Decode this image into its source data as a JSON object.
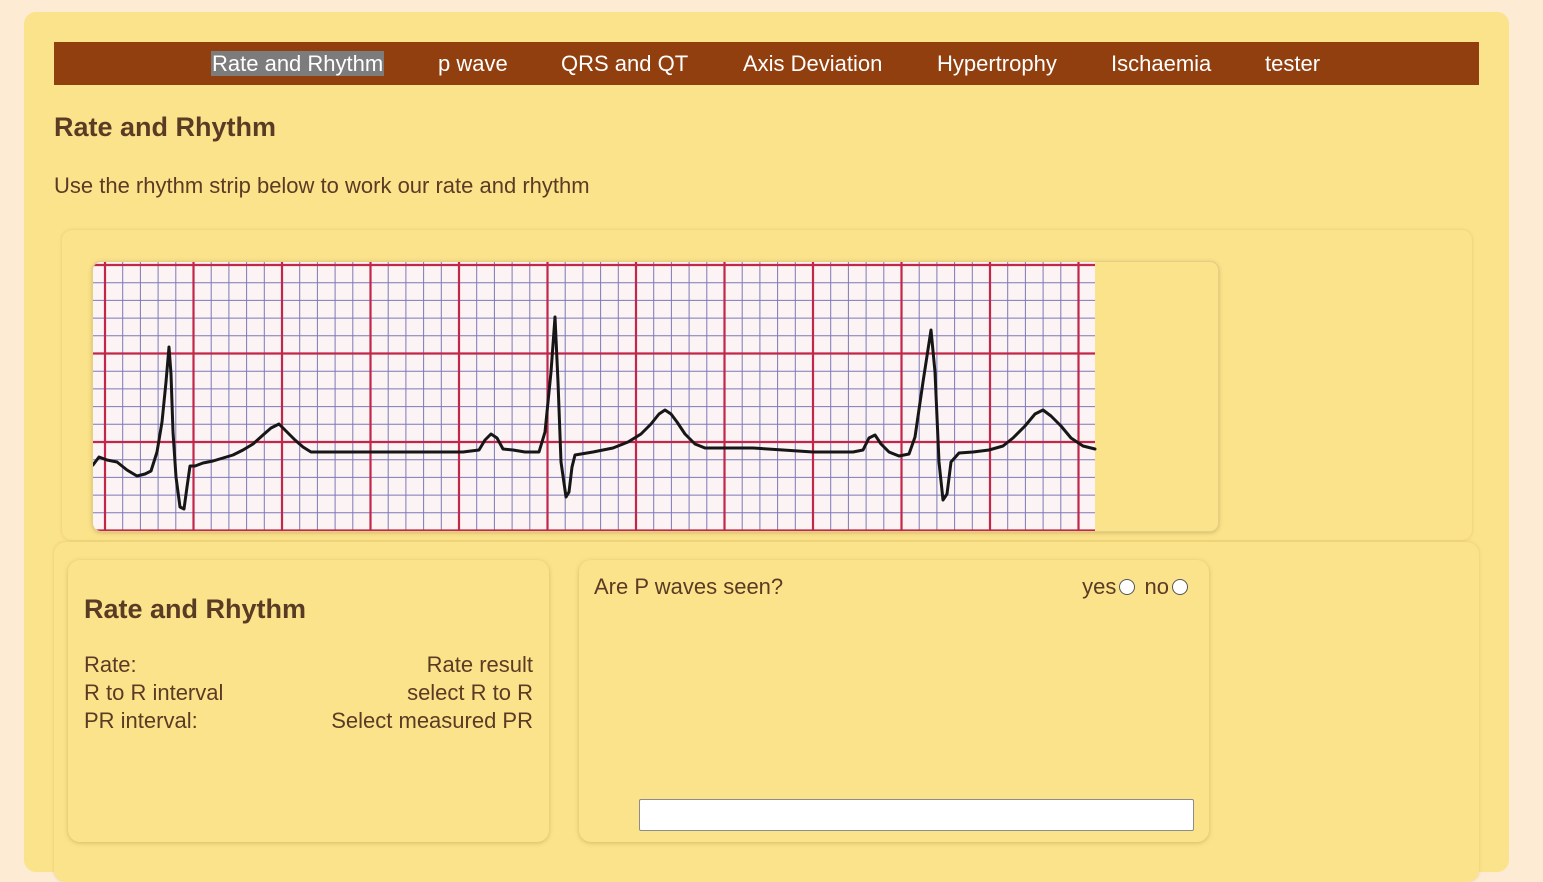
{
  "nav": {
    "items": [
      {
        "label": "Rate and Rhythm",
        "active": true
      },
      {
        "label": "p wave"
      },
      {
        "label": "QRS and QT"
      },
      {
        "label": "Axis Deviation"
      },
      {
        "label": "Hypertrophy"
      },
      {
        "label": "Ischaemia"
      },
      {
        "label": "tester"
      }
    ],
    "background": "#913f0e"
  },
  "page": {
    "title": "Rate and Rhythm",
    "intro": "Use the rhythm strip below to work our rate and rhythm"
  },
  "rhythm_strip": {
    "image": "ecg-rhythm-strip",
    "grid_major_color": "#c2274a",
    "grid_minor_color": "#7e79b6"
  },
  "summary": {
    "title": "Rate and Rhythm",
    "rows": [
      {
        "label": "Rate:",
        "value": "Rate result"
      },
      {
        "label": "R to R interval",
        "value": "select R to R"
      },
      {
        "label": "PR interval:",
        "value": "Select measured PR"
      }
    ]
  },
  "question": {
    "text": "Are P waves seen?",
    "options": [
      "yes",
      "no"
    ],
    "answer_value": ""
  },
  "colors": {
    "page_bg": "#fdebd3",
    "card_bg": "#fbe38b",
    "text": "#5a3b24"
  }
}
